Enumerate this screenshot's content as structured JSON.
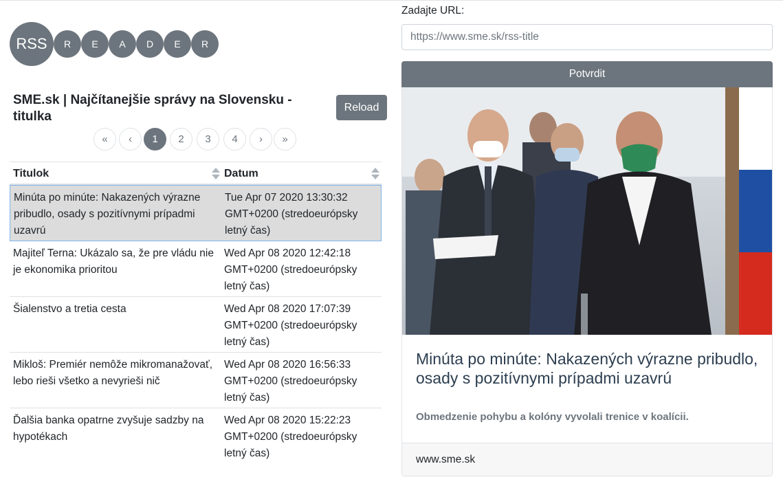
{
  "logo": {
    "big": "RSS",
    "letters": [
      "R",
      "E",
      "A",
      "D",
      "E",
      "R"
    ]
  },
  "feed": {
    "title": "SME.sk | Najčítanejšie správy na Slovensku - titulka",
    "reload_label": "Reload"
  },
  "pagination": {
    "first": "«",
    "prev": "‹",
    "pages": [
      "1",
      "2",
      "3",
      "4"
    ],
    "active_page": "1",
    "next": "›",
    "last": "»"
  },
  "table": {
    "headers": {
      "title": "Titulok",
      "date": "Datum"
    },
    "rows": [
      {
        "title": "Minúta po minúte: Nakazených výrazne pribudlo, osady s pozitívnymi prípadmi uzavrú",
        "date": "Tue Apr 07 2020 13:30:32 GMT+0200 (stredoeurópsky letný čas)"
      },
      {
        "title": "Majiteľ Terna: Ukázalo sa, že pre vládu nie je ekonomika prioritou",
        "date": "Wed Apr 08 2020 12:42:18 GMT+0200 (stredoeurópsky letný čas)"
      },
      {
        "title": "Šialenstvo a tretia cesta",
        "date": "Wed Apr 08 2020 17:07:39 GMT+0200 (stredoeurópsky letný čas)"
      },
      {
        "title": "Mikloš: Premiér nemôže mikromanažovať, lebo rieši všetko a nevyrieši nič",
        "date": "Wed Apr 08 2020 16:56:33 GMT+0200 (stredoeurópsky letný čas)"
      },
      {
        "title": "Ďalšia banka opatrne zvyšuje sadzby na hypotékach",
        "date": "Wed Apr 08 2020 15:22:23 GMT+0200 (stredoeurópsky letný čas)"
      }
    ]
  },
  "url_form": {
    "label": "Zadajte URL:",
    "placeholder": "https://www.sme.sk/rss-title",
    "confirm_label": "Potvrdit"
  },
  "article": {
    "title": "Minúta po minúte: Nakazených výrazne pribudlo, osady s pozitívnymi prípadmi uzavrú",
    "subtitle": "Obmedzenie pohybu a kolóny vyvolali trenice v koalícii.",
    "source": "www.sme.sk",
    "image": "news-photo-people-in-masks"
  },
  "colors": {
    "accent": "#6c757d",
    "selected_row": "#dcdcdc",
    "selected_border": "#80b3ea",
    "article_title": "#2c3e50"
  }
}
